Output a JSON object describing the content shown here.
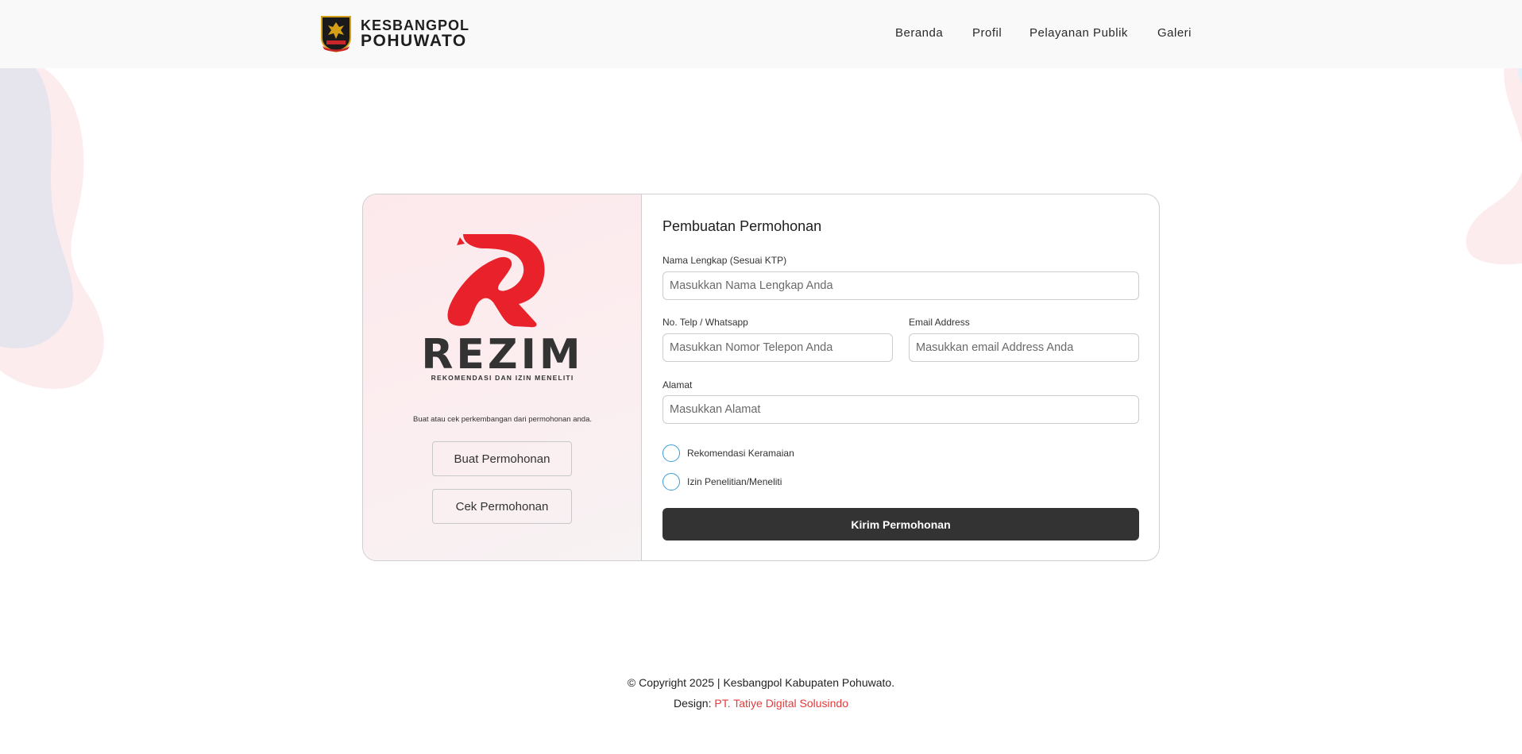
{
  "header": {
    "brand_line1": "KESBANGPOL",
    "brand_line2": "POHUWATO",
    "nav": [
      {
        "label": "Beranda"
      },
      {
        "label": "Profil"
      },
      {
        "label": "Pelayanan Publik"
      },
      {
        "label": "Galeri"
      }
    ]
  },
  "left_panel": {
    "logo_word": "REZIM",
    "logo_tagline": "REKOMENDASI DAN IZIN MENELITI",
    "caption": "Buat atau cek perkembangan dari permohonan anda.",
    "create_button": "Buat Permohonan",
    "check_button": "Cek Permohonan"
  },
  "form": {
    "title": "Pembuatan Permohonan",
    "name_label": "Nama Lengkap (Sesuai KTP)",
    "name_placeholder": "Masukkan Nama Lengkap Anda",
    "phone_label": "No. Telp / Whatsapp",
    "phone_placeholder": "Masukkan Nomor Telepon Anda",
    "email_label": "Email Address",
    "email_placeholder": "Masukkan email Address Anda",
    "address_label": "Alamat",
    "address_placeholder": "Masukkan Alamat",
    "options": [
      {
        "label": "Rekomendasi Keramaian",
        "checked": false
      },
      {
        "label": "Izin Penelitian/Meneliti",
        "checked": false
      }
    ],
    "submit_label": "Kirim Permohonan"
  },
  "footer": {
    "copyright": "© Copyright 2025 | Kesbangpol Kabupaten Pohuwato.",
    "design_prefix": "Design: ",
    "design_company": "PT. Tatiye Digital Solusindo"
  },
  "colors": {
    "accent_red": "#e8212b",
    "dark_button": "#333333",
    "radio_border": "#3a9ad9",
    "link_red": "#e53a3a"
  }
}
